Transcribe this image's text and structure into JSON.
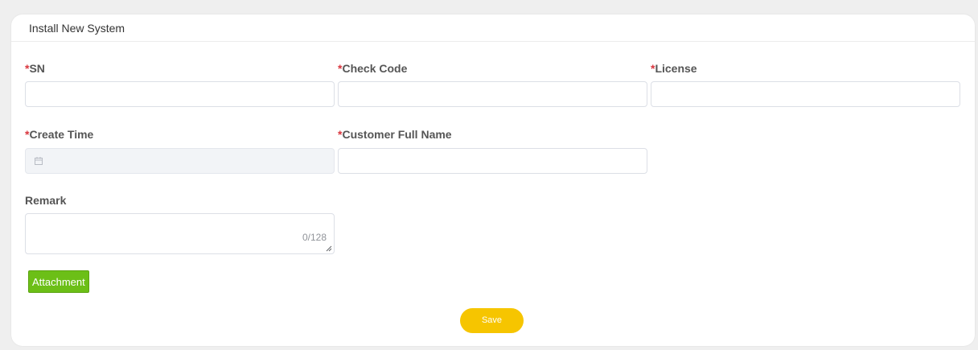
{
  "card": {
    "title": "Install New System"
  },
  "form": {
    "required_mark": "*",
    "sn": {
      "label": "SN",
      "value": ""
    },
    "check_code": {
      "label": "Check Code",
      "value": ""
    },
    "license": {
      "label": "License",
      "value": ""
    },
    "create_time": {
      "label": "Create Time",
      "value": "",
      "icon": "calendar-icon",
      "disabled": true
    },
    "customer_full_name": {
      "label": "Customer Full Name",
      "value": ""
    },
    "remark": {
      "label": "Remark",
      "value": "",
      "counter": "0/128"
    }
  },
  "buttons": {
    "attachment": "Attachment",
    "save": "Save"
  },
  "colors": {
    "required": "#d9363e",
    "attachment_bg": "#6cbf17",
    "save_bg": "#f6c500"
  }
}
